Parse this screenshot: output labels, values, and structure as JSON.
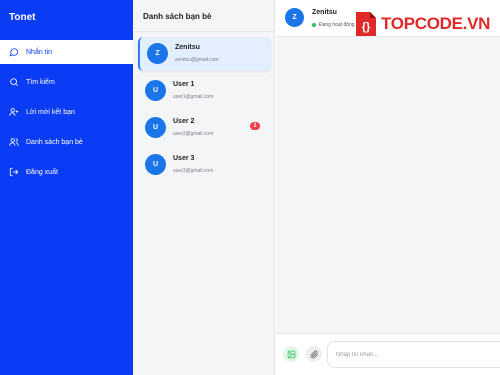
{
  "app": {
    "title": "Tonet"
  },
  "sidebar": {
    "items": [
      {
        "label": "Nhắn tin",
        "icon": "chat-bubble-icon",
        "active": true
      },
      {
        "label": "Tìm kiếm",
        "icon": "search-icon",
        "active": false
      },
      {
        "label": "Lời mời kết bạn",
        "icon": "user-add-icon",
        "active": false
      },
      {
        "label": "Danh sách bạn bè",
        "icon": "users-icon",
        "active": false
      },
      {
        "label": "Đăng xuất",
        "icon": "logout-icon",
        "active": false
      }
    ]
  },
  "friends": {
    "title": "Danh sách bạn bè",
    "list": [
      {
        "initial": "Z",
        "name": "Zenitsu",
        "email": "zenitsu@gmail.com",
        "active": true,
        "badge": ""
      },
      {
        "initial": "U",
        "name": "User 1",
        "email": "user1@gmail.com",
        "active": false,
        "badge": ""
      },
      {
        "initial": "U",
        "name": "User 2",
        "email": "user2@gmail.com",
        "active": false,
        "badge": "2"
      },
      {
        "initial": "U",
        "name": "User 3",
        "email": "user3@gmail.com",
        "active": false,
        "badge": ""
      }
    ]
  },
  "chat": {
    "initial": "Z",
    "name": "Zenitsu",
    "status": "Đang hoạt động",
    "input_placeholder": "Nhập tin nhắn...",
    "colors": {
      "accent": "#0b3cf5",
      "online": "#2dbf5a",
      "badge": "#ef3e48"
    }
  },
  "watermark": {
    "text": "TOPCODE.VN"
  }
}
